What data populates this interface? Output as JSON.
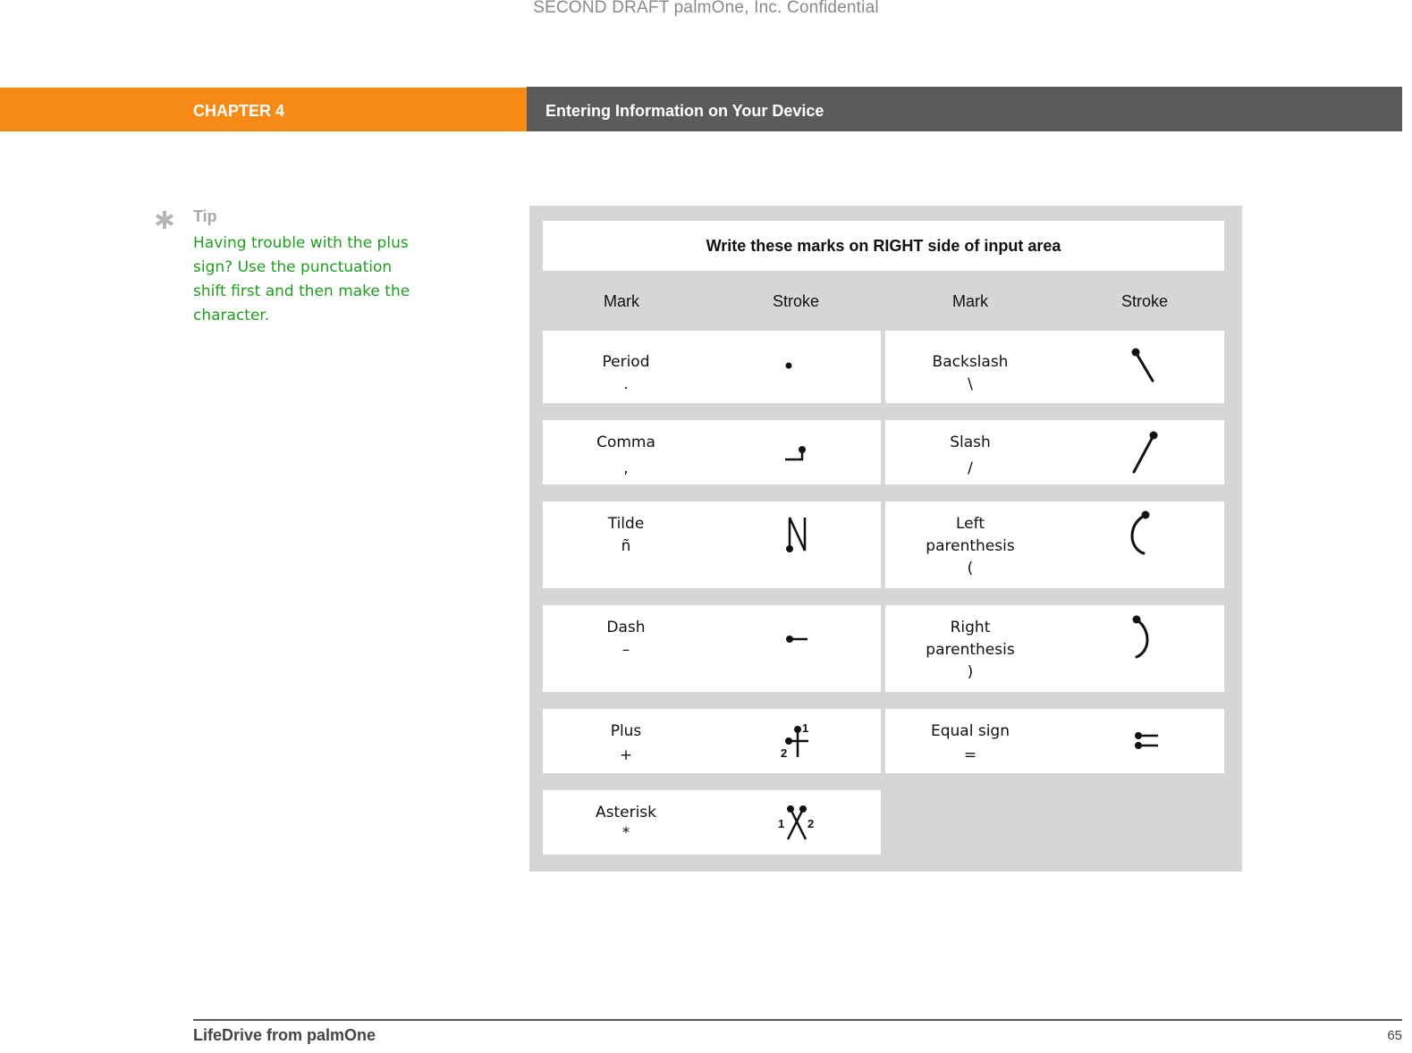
{
  "watermark": "SECOND DRAFT palmOne, Inc.  Confidential",
  "header": {
    "chapter_label": "CHAPTER 4",
    "chapter_title": "Entering Information on Your Device",
    "colors": {
      "chapter_band": "#f78a14",
      "title_band": "#5b5b5b"
    }
  },
  "tip": {
    "icon": "asterisk-icon",
    "heading": "Tip",
    "body": "Having trouble with the plus sign? Use the punctuation shift first and then make the character.",
    "color": "#1f9e1f"
  },
  "table": {
    "title": "Write these marks on RIGHT side of input area",
    "headers": [
      "Mark",
      "Stroke",
      "Mark",
      "Stroke"
    ],
    "rows": [
      {
        "left": {
          "name": "Period",
          "symbol": ".",
          "stroke": "dot"
        },
        "right": {
          "name": "Backslash",
          "symbol": "\\",
          "stroke": "backslash"
        }
      },
      {
        "left": {
          "name": "Comma",
          "symbol": ",",
          "stroke": "comma"
        },
        "right": {
          "name": "Slash",
          "symbol": "/",
          "stroke": "slash"
        }
      },
      {
        "left": {
          "name": "Tilde",
          "symbol": "ñ",
          "stroke": "tilde"
        },
        "right": {
          "name_line1": "Left",
          "name_line2": "parenthesis",
          "symbol": "(",
          "stroke": "left-paren"
        }
      },
      {
        "left": {
          "name": "Dash",
          "symbol": "–",
          "stroke": "dash"
        },
        "right": {
          "name_line1": "Right",
          "name_line2": "parenthesis",
          "symbol": ")",
          "stroke": "right-paren"
        }
      },
      {
        "left": {
          "name": "Plus",
          "symbol": "+",
          "stroke": "plus",
          "stroke_labels": [
            "1",
            "2"
          ]
        },
        "right": {
          "name": "Equal sign",
          "symbol": "=",
          "stroke": "equal"
        }
      },
      {
        "left": {
          "name": "Asterisk",
          "symbol": "*",
          "stroke": "asterisk",
          "stroke_labels": [
            "1",
            "2"
          ]
        }
      }
    ]
  },
  "footer": {
    "book_title": "LifeDrive from palmOne",
    "page_number": "65"
  }
}
